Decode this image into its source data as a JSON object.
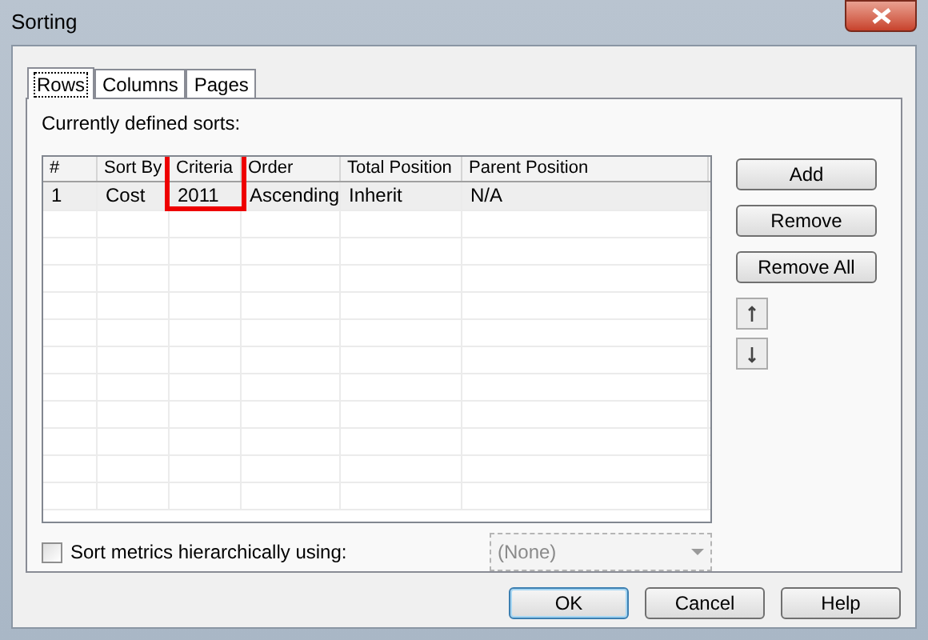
{
  "window": {
    "title": "Sorting"
  },
  "tabs": [
    {
      "label": "Rows",
      "selected": true
    },
    {
      "label": "Columns",
      "selected": false
    },
    {
      "label": "Pages",
      "selected": false
    }
  ],
  "sorts_label": "Currently defined sorts:",
  "table": {
    "columns": [
      {
        "label": "#",
        "highlighted": false
      },
      {
        "label": "Sort By",
        "highlighted": false
      },
      {
        "label": "Criteria",
        "highlighted": true
      },
      {
        "label": "Order",
        "highlighted": false
      },
      {
        "label": "Total Position",
        "highlighted": false
      },
      {
        "label": "Parent Position",
        "highlighted": false
      }
    ],
    "rows": [
      {
        "cells": [
          "1",
          "Cost",
          "2011",
          "Ascending",
          "Inherit",
          "N/A"
        ],
        "selected": true
      }
    ]
  },
  "side_buttons": [
    "Add",
    "Remove",
    "Remove All"
  ],
  "hierarchy": {
    "label": "Sort metrics hierarchically using:",
    "checked": false,
    "value": "(None)",
    "disabled": true
  },
  "footer_buttons": [
    {
      "label": "OK",
      "default": true
    },
    {
      "label": "Cancel",
      "default": false
    },
    {
      "label": "Help",
      "default": false
    }
  ]
}
